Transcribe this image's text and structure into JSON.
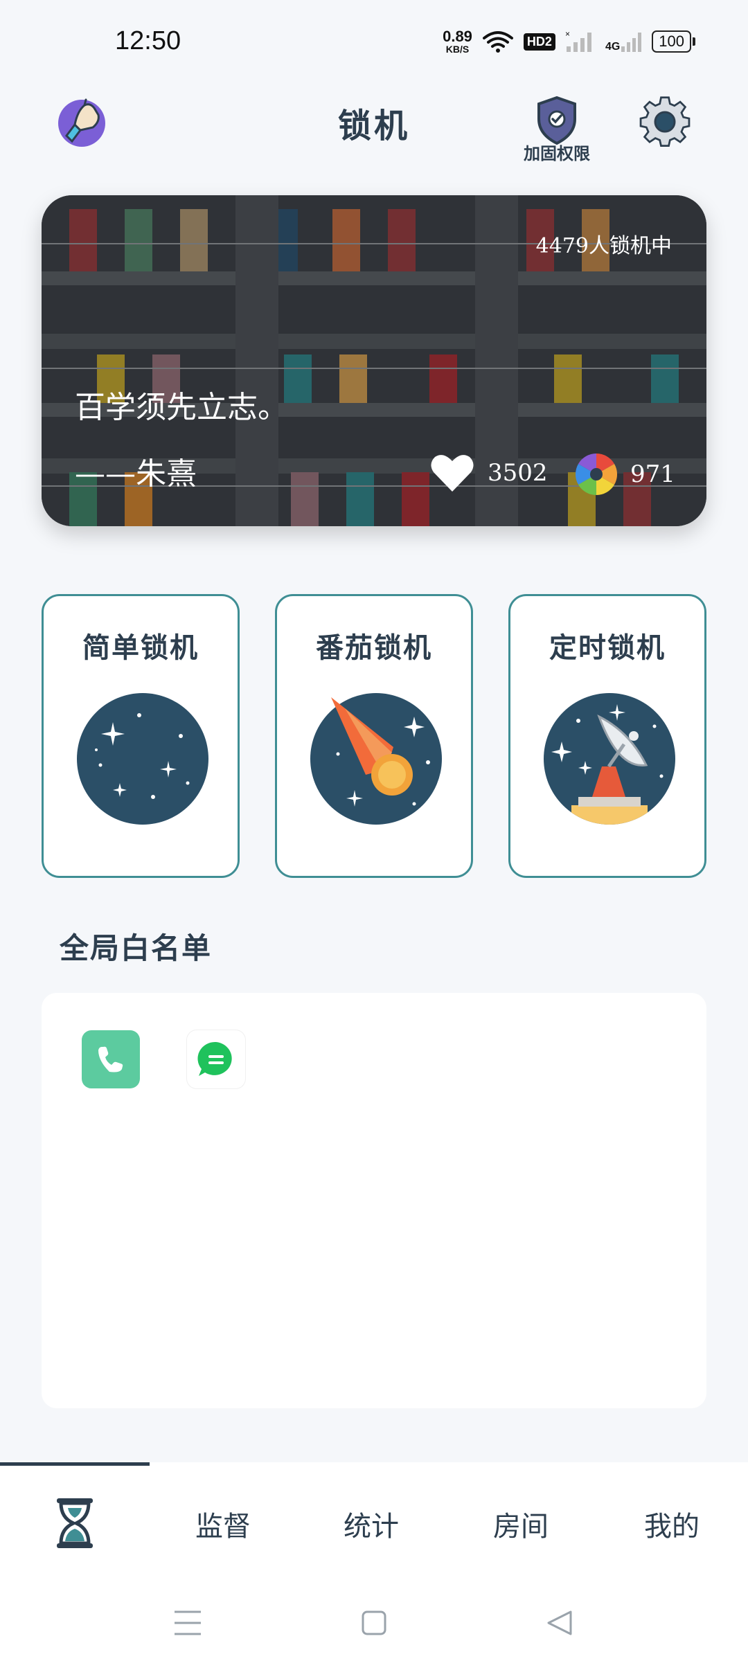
{
  "status_bar": {
    "time": "12:50",
    "net_speed_value": "0.89",
    "net_speed_unit": "KB/S",
    "hd_badge": "HD2",
    "network_type": "4G",
    "battery": "100"
  },
  "header": {
    "title": "锁机",
    "shield_label": "加固权限",
    "avatar_icon": "hand-avatar-icon",
    "settings_icon": "gear-icon"
  },
  "banner": {
    "online_count": "4479人锁机中",
    "quote": "百学须先立志。",
    "author": "——朱熹",
    "likes": "3502",
    "shares": "971"
  },
  "modes": [
    {
      "label": "简单锁机",
      "icon": "starry-planet-icon"
    },
    {
      "label": "番茄锁机",
      "icon": "comet-icon"
    },
    {
      "label": "定时锁机",
      "icon": "satellite-dish-icon"
    }
  ],
  "whitelist": {
    "title": "全局白名单",
    "apps": [
      {
        "name": "phone",
        "icon": "phone-icon"
      },
      {
        "name": "messages",
        "icon": "message-icon"
      }
    ]
  },
  "bottom_nav": {
    "items": [
      "监督",
      "统计",
      "房间",
      "我的"
    ],
    "active_icon": "hourglass-icon"
  },
  "colors": {
    "primary": "#2d3e4e",
    "card_border": "#3f8e94",
    "planet": "#2b4f67",
    "comet": "#f26b3a",
    "phone_app": "#5ccb9f",
    "message_app": "#1fc25c"
  }
}
